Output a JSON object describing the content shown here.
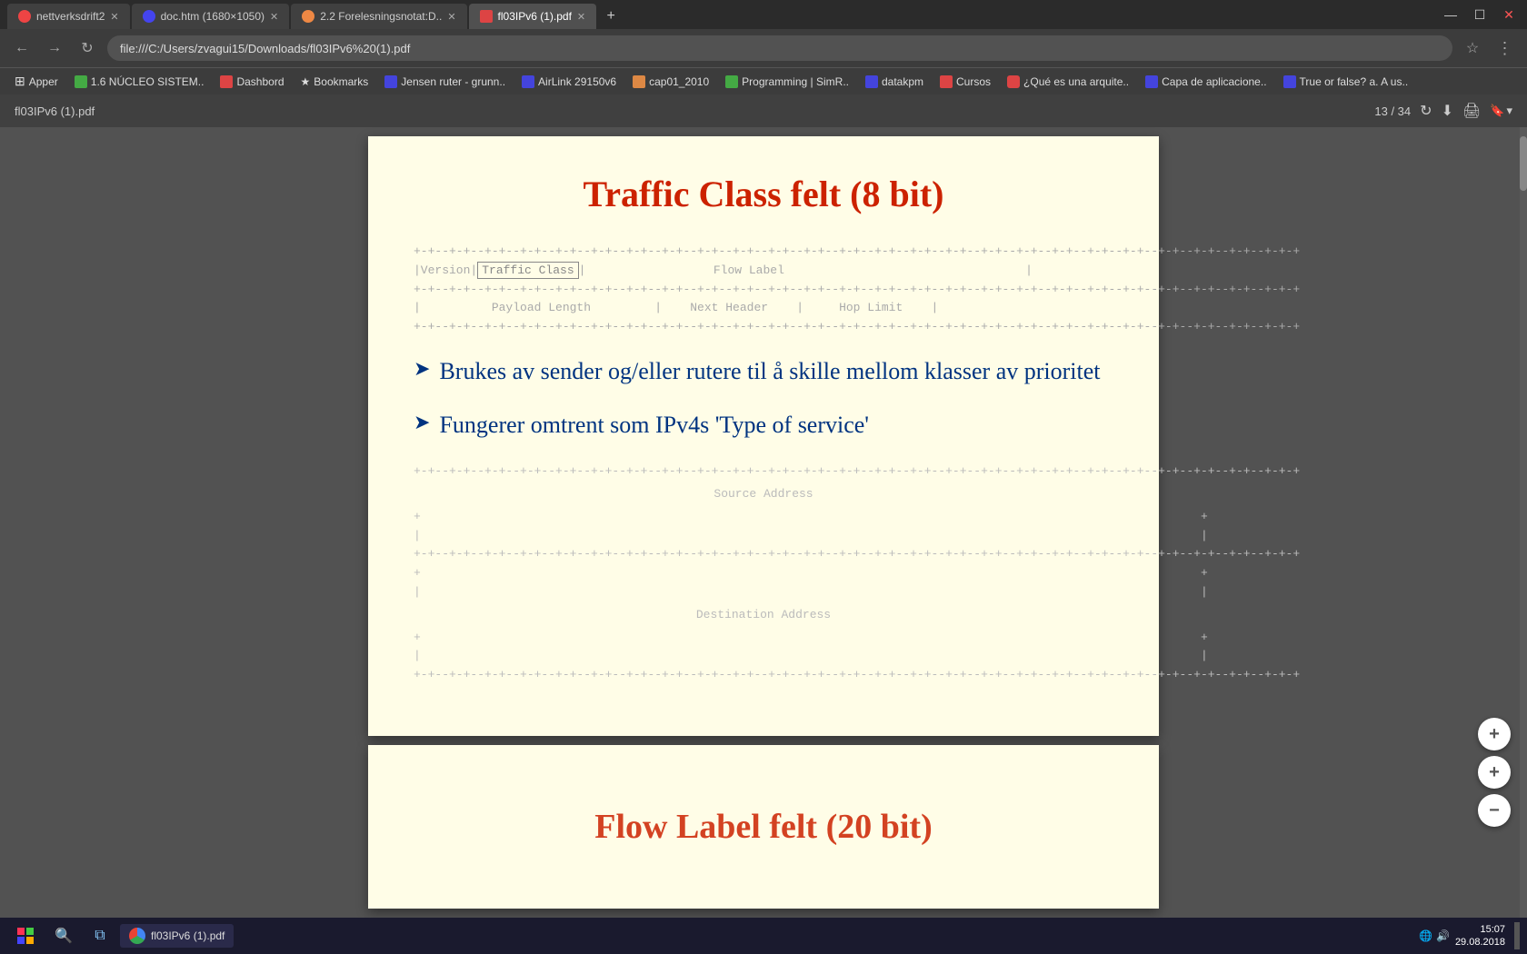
{
  "browser": {
    "tabs": [
      {
        "id": "tab1",
        "label": "nettverksdrift2",
        "active": false,
        "favicon": "red"
      },
      {
        "id": "tab2",
        "label": "doc.htm (1680×1050)",
        "active": false,
        "favicon": "blue"
      },
      {
        "id": "tab3",
        "label": "2.2 Forelesningsnotat:D..",
        "active": false,
        "favicon": "orange"
      },
      {
        "id": "tab4",
        "label": "fl03IPv6 (1).pdf",
        "active": true,
        "favicon": "pdf"
      }
    ],
    "address": "file:///C:/Users/zvagui15/Downloads/fl03IPv6%20(1).pdf",
    "window_controls": [
      "—",
      "☐",
      "✕"
    ]
  },
  "bookmarks": [
    {
      "label": "Apper",
      "favicon": "none"
    },
    {
      "label": "1.6 NÚCLEO SISTEM..",
      "favicon": "green"
    },
    {
      "label": "Dashbord",
      "favicon": "red"
    },
    {
      "label": "Bookmarks",
      "favicon": "blue"
    },
    {
      "label": "Jensen ruter - grunn..",
      "favicon": "blue"
    },
    {
      "label": "AirLink 29150v6",
      "favicon": "blue"
    },
    {
      "label": "cap01_2010",
      "favicon": "orange"
    },
    {
      "label": "Programming | SimR..",
      "favicon": "green"
    },
    {
      "label": "datakpm",
      "favicon": "blue"
    },
    {
      "label": "Cursos",
      "favicon": "red"
    },
    {
      "label": "¿Qué es una arquite..",
      "favicon": "youtube"
    },
    {
      "label": "Capa de aplicacione..",
      "favicon": "blue"
    },
    {
      "label": "True or false? a. A us..",
      "favicon": "blue"
    }
  ],
  "pdf": {
    "title": "fl03IPv6 (1).pdf",
    "current_page": "13",
    "total_pages": "34",
    "page_info": "13 / 34"
  },
  "slide": {
    "title": "Traffic Class felt (8 bit)",
    "diagram": {
      "row1_separator": "+-+--+---+---+---+---+---+---+---+---+---+---+---+---+---+---+---+---+---+---+---+---+---+---+---+---+---+---+---+---+---+",
      "row1_fields": "|Version|  Traffic Class |                         Flow Label                             |",
      "row2_separator": "+-+--+---+---+---+---+---+---+---+---+---+---+---+---+---+---+---+---+---+---+---+---+---+---+---+---+---+---+---+---+---+",
      "row2_fields": "|         Payload Length        |    Next Header    |     Hop Limit    |",
      "row3_separator": "+-+--+---+---+---+---+---+---+---+---+---+---+---+---+---+---+---+---+---+---+---+---+---+---+---+---+---+---+---+---+---+",
      "source_label": "Source Address",
      "source_rows": [
        "|                                                                              |",
        "+                                                                              +",
        "|                                                                              |"
      ],
      "dest_label": "Destination Address",
      "dest_rows": [
        "+                                                                              +",
        "|                                                                              |",
        "+                                                                              +",
        "|                                                                              |",
        "+                                                                              +"
      ],
      "bottom_separator": "+-+--+---+---+---+---+---+---+---+---+---+---+---+---+---+---+---+---+---+---+---+---+---+---+---+---+---+---+---+---+---+"
    },
    "bullets": [
      {
        "text": "Brukes av sender og/eller rutere til å skille mellom klasser av prioritet"
      },
      {
        "text": "Fungerer omtrent som IPv4s 'Type of service'"
      }
    ]
  },
  "page2": {
    "partial_title": "Flow Label felt (20 bit)"
  },
  "taskbar": {
    "time": "15:07",
    "date": "29.08.2018"
  },
  "zoom_buttons": {
    "plus_large": "+",
    "plus_small": "+",
    "minus": "−"
  }
}
